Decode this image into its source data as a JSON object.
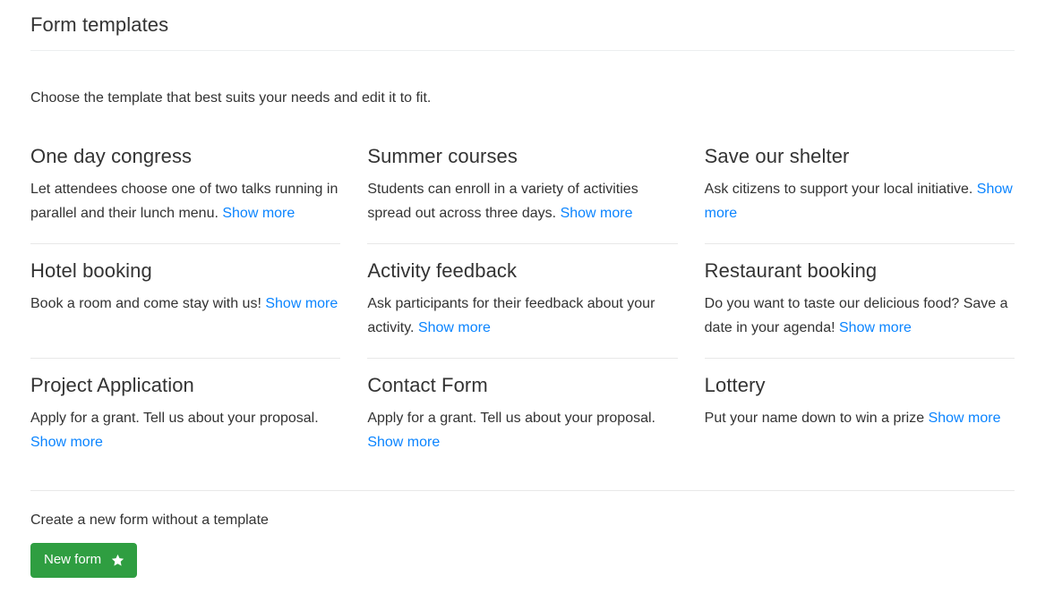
{
  "header": {
    "title": "Form templates"
  },
  "intro": {
    "text": "Choose the template that best suits your needs and edit it to fit."
  },
  "templates": [
    {
      "title": "One day congress",
      "description": "Let attendees choose one of two talks running in parallel and their lunch menu.",
      "link_label": "Show more"
    },
    {
      "title": "Summer courses",
      "description": "Students can enroll in a variety of activities spread out across three days.",
      "link_label": "Show more"
    },
    {
      "title": "Save our shelter",
      "description": "Ask citizens to support your local initiative.",
      "link_label": "Show more"
    },
    {
      "title": "Hotel booking",
      "description": "Book a room and come stay with us!",
      "link_label": "Show more"
    },
    {
      "title": "Activity feedback",
      "description": "Ask participants for their feedback about your activity.",
      "link_label": "Show more"
    },
    {
      "title": "Restaurant booking",
      "description": "Do you want to taste our delicious food? Save a date in your agenda!",
      "link_label": "Show more"
    },
    {
      "title": "Project Application",
      "description": "Apply for a grant. Tell us about your proposal.",
      "link_label": "Show more"
    },
    {
      "title": "Contact Form",
      "description": "Apply for a grant. Tell us about your proposal.",
      "link_label": "Show more"
    },
    {
      "title": "Lottery",
      "description": "Put your name down to win a prize",
      "link_label": "Show more"
    }
  ],
  "footer": {
    "label": "Create a new form without a template",
    "new_form_label": "New form",
    "new_form_icon": "star-icon"
  },
  "colors": {
    "link": "#0a84ff",
    "button_green": "#2f9e41",
    "text": "#333333",
    "divider": "#e8e8e8"
  }
}
